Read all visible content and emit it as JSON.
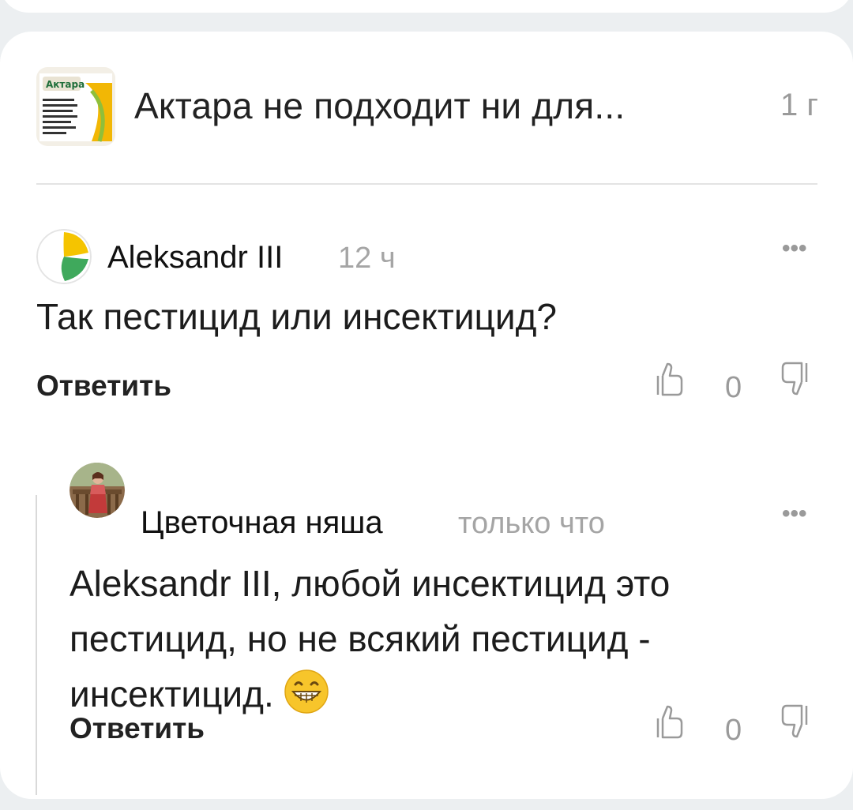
{
  "article": {
    "title": "Актара не подходит ни для...",
    "time": "1 г",
    "thumb_brand": "Актара"
  },
  "comments": [
    {
      "author": "Aleksandr III",
      "time": "12 ч",
      "text": "Так пестицид или инсектицид?",
      "reply_label": "Ответить",
      "likes": "0"
    },
    {
      "author": "Цветочная няша",
      "time": "только что",
      "text": "Aleksandr III, любой инсектицид это пестицид, но не всякий пестицид - инсектицид.",
      "reply_label": "Ответить",
      "likes": "0"
    }
  ],
  "icons": {
    "more": "more-dots-icon",
    "like": "thumb-up-icon",
    "dislike": "thumb-down-icon",
    "emoji": "grinning-emoji"
  },
  "colors": {
    "background": "#eceff1",
    "card": "#ffffff",
    "muted": "#9a9a9a"
  }
}
